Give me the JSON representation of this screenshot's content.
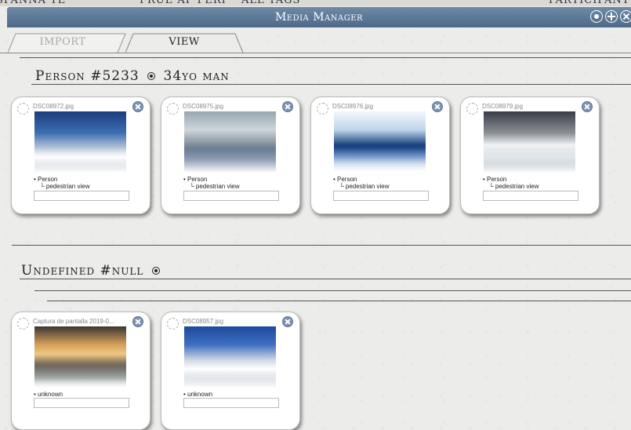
{
  "top_strip": {
    "left": "SPANNA TE",
    "middle": "FRUE AP PERI",
    "tags": "ALL TAGS",
    "right": "PARTICIPANT"
  },
  "window": {
    "title": "Media Manager"
  },
  "tabs": [
    {
      "label": "IMPORT",
      "active": false
    },
    {
      "label": "VIEW",
      "active": true
    }
  ],
  "groups": [
    {
      "id": "person",
      "heading_main": "Person #5233",
      "heading_sub": "34yo man",
      "cards": [
        {
          "filename": "DSC08972.jpg",
          "tag": "• Person",
          "subtag": "└ pedestrian view",
          "thumb": "waterfall-spillway-photo"
        },
        {
          "filename": "DSC08975.jpg",
          "tag": "• Person",
          "subtag": "└ pedestrian view",
          "thumb": "dam-building-photo"
        },
        {
          "filename": "DSC08976.jpg",
          "tag": "• Person",
          "subtag": "└ pedestrian view",
          "thumb": "duck-icy-water-photo"
        },
        {
          "filename": "DSC08979.jpg",
          "tag": "• Person",
          "subtag": "└ pedestrian view",
          "thumb": "snowy-river-photo"
        }
      ]
    },
    {
      "id": "undefined",
      "heading_main": "Undefined #null",
      "heading_sub": "",
      "cards": [
        {
          "filename": "Captura de pantalla 2019-0...",
          "tag": "• unknown",
          "thumb": "sunset-snow-forest-photo"
        },
        {
          "filename": "DSC08957.jpg",
          "tag": "• unknown",
          "thumb": "dam-spillway-photo"
        }
      ]
    }
  ],
  "colors": {
    "titlebar": "#5a7597",
    "close_button": "#7c93b2",
    "background": "#ececea"
  }
}
